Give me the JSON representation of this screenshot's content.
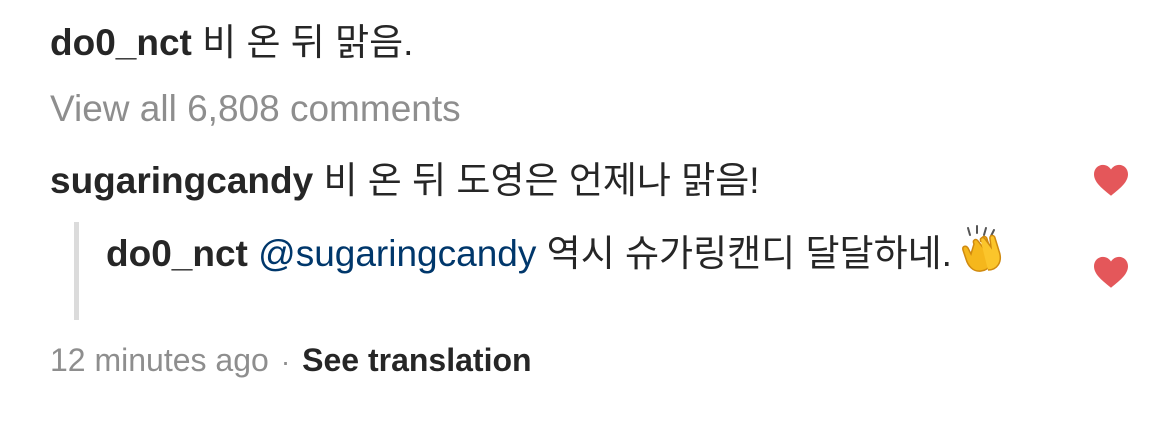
{
  "caption": {
    "username": "do0_nct",
    "text": "비 온 뒤 맑음."
  },
  "view_all_comments": "View all 6,808 comments",
  "comment": {
    "username": "sugaringcandy",
    "text": "비 온 뒤 도영은 언제나 맑음!"
  },
  "reply": {
    "username": "do0_nct",
    "mention": "@sugaringcandy",
    "text": "역시 슈가링캔디 달달하네.",
    "emoji": "clapping-hands"
  },
  "meta": {
    "timestamp": "12 minutes ago",
    "separator": "·",
    "see_translation": "See translation"
  },
  "colors": {
    "text": "#262626",
    "secondary": "#8e8e8e",
    "mention": "#00376b",
    "heart": "#e4575a",
    "rule": "#dbdbdb"
  },
  "icons": [
    "heart-icon",
    "clapping-hands-emoji"
  ]
}
